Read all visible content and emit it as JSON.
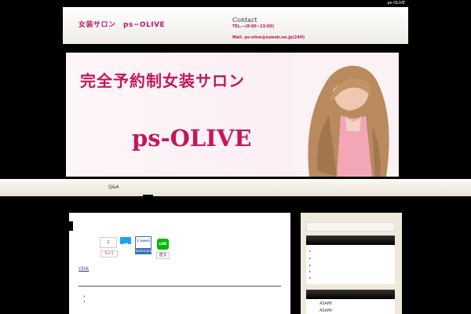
{
  "topbar": {
    "tag": "ps-OLIVE"
  },
  "header": {
    "site_title": "女装サロン　ps−OLIVE",
    "contact_title": "Contact",
    "tel": "TEL.--(8:00~23:00)",
    "mail": "Mail. ps-olive@ezweb.ne.jp(24H)"
  },
  "banner": {
    "catch": "完全予約制女装サロン",
    "name": "ps-OLIVE"
  },
  "nav": {
    "items": [
      {
        "label": "Q&A"
      }
    ]
  },
  "share": {
    "fb_count": "1",
    "google_label": "G+1",
    "hatena_users": "1 users",
    "hatena_label": "bookmark",
    "line_label": "LINE",
    "line_count": "送る"
  },
  "content": {
    "link": "click",
    "bullets": [
      "•",
      "•"
    ]
  },
  "sidebar": {
    "list_markers": [
      "▸",
      "▸",
      "▸",
      "▸",
      "▸"
    ],
    "names": [
      "ASAMI",
      "ASAMI"
    ]
  }
}
